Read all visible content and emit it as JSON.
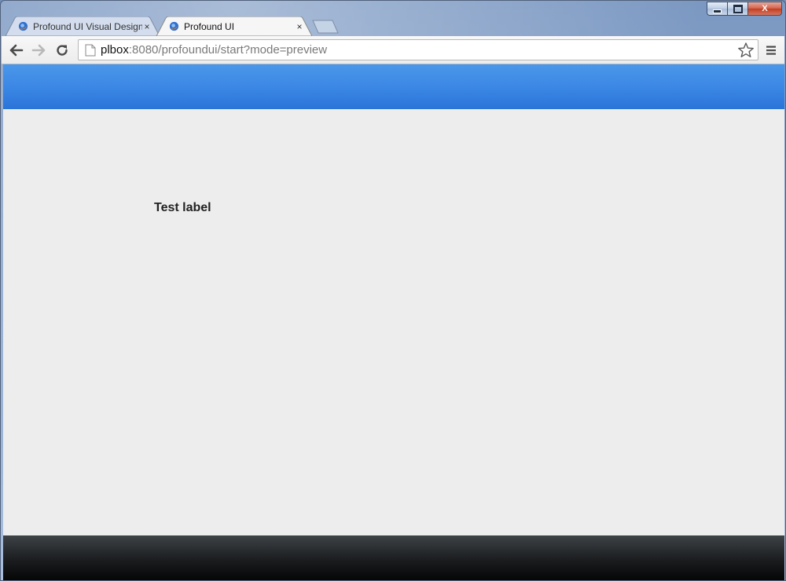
{
  "browser": {
    "tabs": [
      {
        "title": "Profound UI Visual Design",
        "active": false
      },
      {
        "title": "Profound UI",
        "active": true
      }
    ],
    "tab_close_glyph": "×",
    "address": {
      "host": "plbox",
      "rest": ":8080/profoundui/start?mode=preview"
    },
    "icons": {
      "back": "arrow-left-icon",
      "forward": "arrow-right-icon",
      "reload": "reload-icon",
      "bookmark": "star-icon",
      "menu": "hamburger-menu-icon",
      "page": "page-icon"
    }
  },
  "window": {
    "caption_buttons": [
      "minimize",
      "maximize",
      "close"
    ],
    "close_glyph": "X"
  },
  "page": {
    "label": "Test label",
    "colors": {
      "header_blue": "#3a86e4",
      "background": "#ededed",
      "footer_dark": "#1a1c1e"
    }
  }
}
